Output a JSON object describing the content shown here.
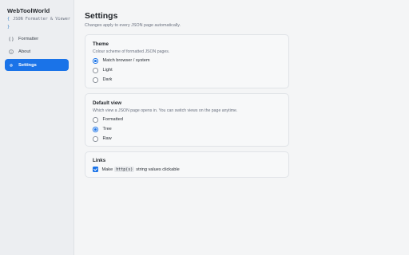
{
  "app": {
    "name": "WebToolWorld",
    "subtitle_brace_open": "{",
    "subtitle_brace_close": "}",
    "subtitle_line1": "JSON Formatter & Viewer"
  },
  "nav": {
    "items": [
      {
        "label": "Formatter",
        "icon": "braces-icon",
        "active": false
      },
      {
        "label": "About",
        "icon": "info-icon",
        "active": false
      },
      {
        "label": "Settings",
        "icon": "gear-icon",
        "active": true
      }
    ]
  },
  "page": {
    "title": "Settings",
    "subtitle": "Changes apply to every JSON page automatically."
  },
  "theme": {
    "title": "Theme",
    "description": "Colour scheme of formatted JSON pages.",
    "options": [
      "Match browser / system",
      "Light",
      "Dark"
    ],
    "selected": "Match browser / system"
  },
  "default_view": {
    "title": "Default view",
    "description": "Which view a JSON page opens in. You can switch views on the page anytime.",
    "options": [
      "Formatted",
      "Tree",
      "Raw"
    ],
    "selected": "Tree"
  },
  "links": {
    "title": "Links",
    "checkbox_prefix": "Make",
    "checkbox_code": "http(s)",
    "checkbox_suffix": "string values clickable",
    "checked": true
  },
  "colors": {
    "accent": "#1a73e8",
    "sidebar_bg": "#eceef1",
    "page_bg": "#f4f5f6"
  }
}
